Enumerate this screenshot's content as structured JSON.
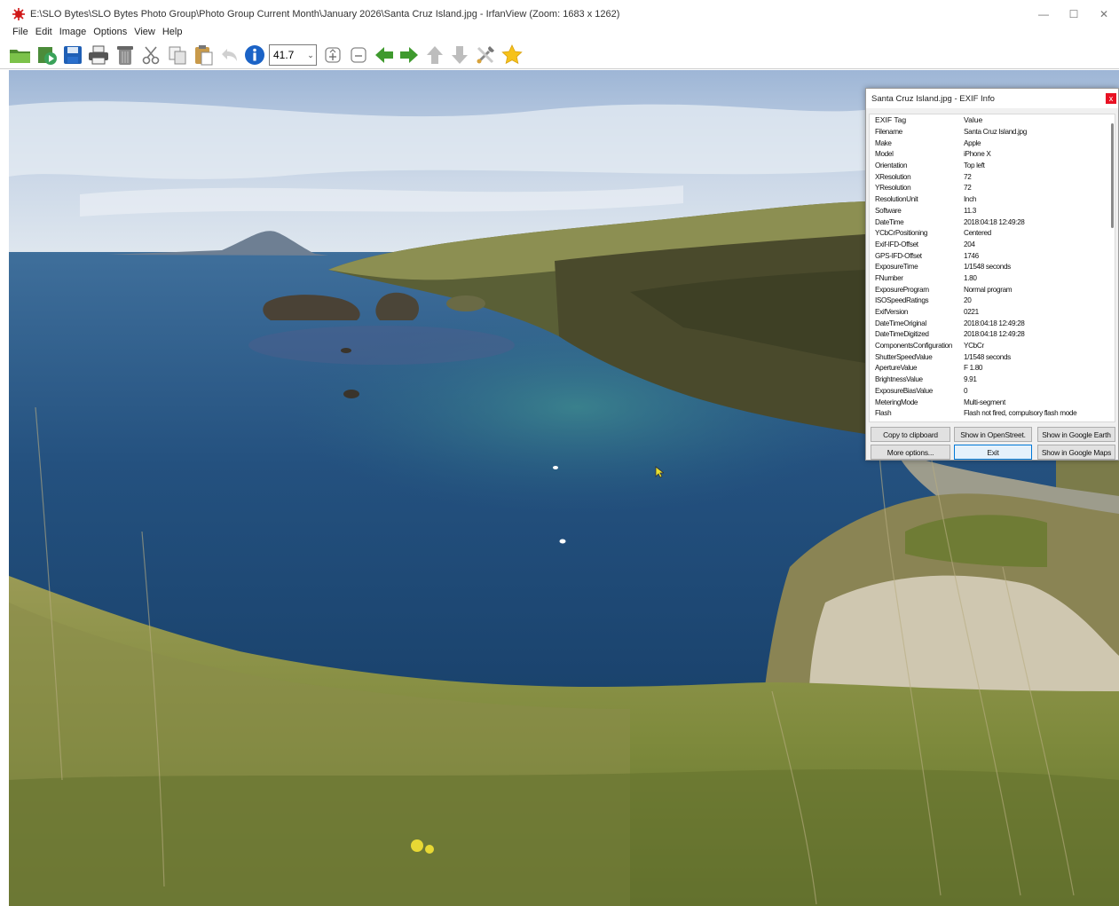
{
  "window": {
    "title": "E:\\SLO Bytes\\SLO Bytes Photo Group\\Photo Group Current Month\\January 2026\\Santa Cruz Island.jpg - IrfanView (Zoom: 1683 x 1262)",
    "minimize_glyph": "—",
    "maximize_glyph": "☐",
    "close_glyph": "✕"
  },
  "menu": [
    "File",
    "Edit",
    "Image",
    "Options",
    "View",
    "Help"
  ],
  "toolbar": {
    "icons": [
      "open-folder-icon",
      "slideshow-icon",
      "save-icon",
      "print-icon",
      "delete-icon",
      "cut-icon",
      "copy-icon",
      "paste-icon",
      "undo-icon",
      "info-icon",
      "zoom-in-icon",
      "zoom-out-icon",
      "previous-icon",
      "next-icon",
      "first-icon",
      "last-icon",
      "properties-icon",
      "favorites-icon"
    ],
    "zoom_value": "41.7",
    "zoom_arrow": "⌄"
  },
  "exif": {
    "title": "Santa Cruz Island.jpg - EXIF Info",
    "close_label": "x",
    "header": {
      "tag": "EXIF Tag",
      "value": "Value"
    },
    "rows": [
      {
        "tag": "Filename",
        "value": "Santa Cruz Island.jpg"
      },
      {
        "tag": "Make",
        "value": "Apple"
      },
      {
        "tag": "Model",
        "value": "iPhone X"
      },
      {
        "tag": "Orientation",
        "value": "Top left"
      },
      {
        "tag": "XResolution",
        "value": "72"
      },
      {
        "tag": "YResolution",
        "value": "72"
      },
      {
        "tag": "ResolutionUnit",
        "value": "Inch"
      },
      {
        "tag": "Software",
        "value": "11.3"
      },
      {
        "tag": "DateTime",
        "value": "2018:04:18 12:49:28"
      },
      {
        "tag": "YCbCrPositioning",
        "value": "Centered"
      },
      {
        "tag": "Exif-IFD-Offset",
        "value": "204"
      },
      {
        "tag": "GPS-IFD-Offset",
        "value": "1746"
      },
      {
        "tag": "ExposureTime",
        "value": "1/1548 seconds"
      },
      {
        "tag": "FNumber",
        "value": "1.80"
      },
      {
        "tag": "ExposureProgram",
        "value": "Normal program"
      },
      {
        "tag": "ISOSpeedRatings",
        "value": "20"
      },
      {
        "tag": "ExifVersion",
        "value": "0221"
      },
      {
        "tag": "DateTimeOriginal",
        "value": "2018:04:18 12:49:28"
      },
      {
        "tag": "DateTimeDigitized",
        "value": "2018:04:18 12:49:28"
      },
      {
        "tag": "ComponentsConfiguration",
        "value": "YCbCr"
      },
      {
        "tag": "ShutterSpeedValue",
        "value": "1/1548 seconds"
      },
      {
        "tag": "ApertureValue",
        "value": "F 1.80"
      },
      {
        "tag": "BrightnessValue",
        "value": "9.91"
      },
      {
        "tag": "ExposureBiasValue",
        "value": "0"
      },
      {
        "tag": "MeteringMode",
        "value": "Multi-segment"
      },
      {
        "tag": "Flash",
        "value": "Flash not fired, compulsory flash mode"
      }
    ],
    "buttons": {
      "copy": "Copy to clipboard",
      "openstreet": "Show in OpenStreet.",
      "google_earth": "Show in Google Earth",
      "more": "More options...",
      "exit": "Exit",
      "google_maps": "Show in Google Maps"
    }
  }
}
